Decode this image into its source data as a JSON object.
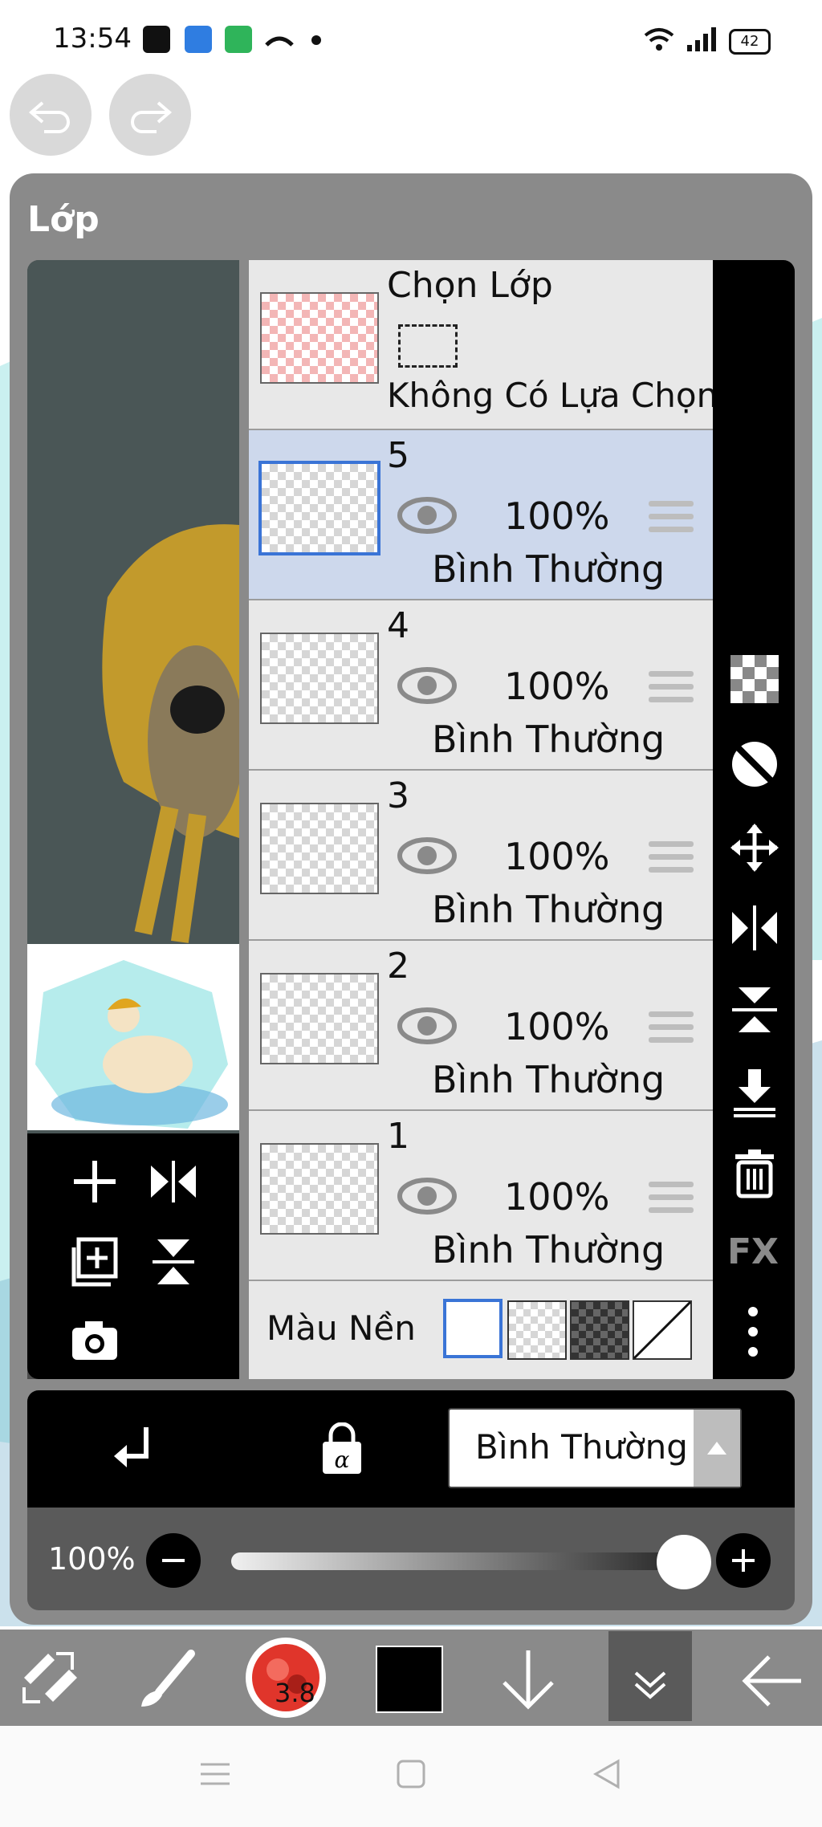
{
  "status_bar": {
    "time": "13:54",
    "battery": "42",
    "notification_icons": [
      "baomoi-icon",
      "blue-app-icon",
      "green-app-icon",
      "missed-call-icon",
      "dot-icon"
    ]
  },
  "layers_panel": {
    "title": "Lớp",
    "selection_layer": {
      "title": "Chọn Lớp",
      "status": "Không Có Lựa Chọn"
    },
    "layers": [
      {
        "number": "5",
        "opacity": "100%",
        "blend": "Bình Thường",
        "selected": true
      },
      {
        "number": "4",
        "opacity": "100%",
        "blend": "Bình Thường",
        "selected": false
      },
      {
        "number": "3",
        "opacity": "100%",
        "blend": "Bình Thường",
        "selected": false
      },
      {
        "number": "2",
        "opacity": "100%",
        "blend": "Bình Thường",
        "selected": false
      },
      {
        "number": "1",
        "opacity": "100%",
        "blend": "Bình Thường",
        "selected": false
      }
    ],
    "background_label": "Màu Nền",
    "right_tools": {
      "fx_label": "FX"
    }
  },
  "blend_controls": {
    "blend_mode": "Bình Thường"
  },
  "opacity_controls": {
    "value": "100%",
    "fraction": 1.0
  },
  "toolbar": {
    "brush_size": "3.8"
  },
  "colors": {
    "selected_row": "#cdd8ec",
    "selection_border": "#3a74d6",
    "panel": "#8a8a8a"
  }
}
